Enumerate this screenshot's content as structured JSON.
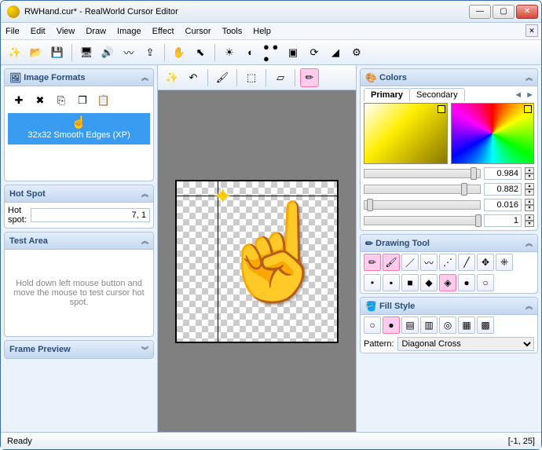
{
  "window": {
    "title": "RWHand.cur* - RealWorld Cursor Editor"
  },
  "menu": [
    "File",
    "Edit",
    "View",
    "Draw",
    "Image",
    "Effect",
    "Cursor",
    "Tools",
    "Help"
  ],
  "panels": {
    "image_formats": {
      "title": "Image Formats",
      "selected": "32x32 Smooth Edges (XP)"
    },
    "hot_spot": {
      "title": "Hot Spot",
      "label": "Hot spot:",
      "value": "7, 1"
    },
    "test_area": {
      "title": "Test Area",
      "hint": "Hold down left mouse button and move the mouse to test cursor hot spot."
    },
    "frame_preview": {
      "title": "Frame Preview"
    },
    "colors": {
      "title": "Colors",
      "tab_primary": "Primary",
      "tab_secondary": "Secondary",
      "values": {
        "r": "0.984",
        "g": "0.882",
        "b": "0.016",
        "a": "1"
      }
    },
    "drawing_tool": {
      "title": "Drawing Tool"
    },
    "fill_style": {
      "title": "Fill Style",
      "pattern_label": "Pattern:",
      "pattern_value": "Diagonal Cross"
    }
  },
  "status": {
    "ready": "Ready",
    "coords": "[-1, 25]"
  },
  "chart_data": null
}
